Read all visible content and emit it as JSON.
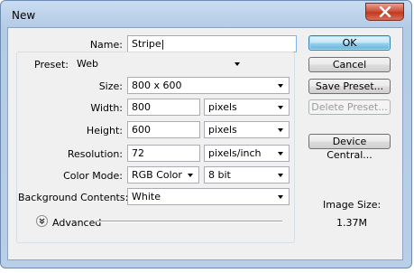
{
  "window": {
    "title": "New"
  },
  "name_row": {
    "label": "Name:",
    "value": "Stripe"
  },
  "preset": {
    "label": "Preset:",
    "value": "Web"
  },
  "size": {
    "label": "Size:",
    "value": "800 x 600"
  },
  "width": {
    "label": "Width:",
    "value": "800",
    "unit": "pixels"
  },
  "height": {
    "label": "Height:",
    "value": "600",
    "unit": "pixels"
  },
  "resolution": {
    "label": "Resolution:",
    "value": "72",
    "unit": "pixels/inch"
  },
  "color_mode": {
    "label": "Color Mode:",
    "value": "RGB Color",
    "depth": "8 bit"
  },
  "background": {
    "label": "Background Contents:",
    "value": "White"
  },
  "advanced": {
    "label": "Advanced"
  },
  "buttons": {
    "ok": "OK",
    "cancel": "Cancel",
    "save_preset": "Save Preset...",
    "delete_preset": "Delete Preset...",
    "device_central": "Device Central..."
  },
  "image_size": {
    "label": "Image Size:",
    "value": "1.37M"
  },
  "icons": {
    "close": "close-icon",
    "advanced": "chevron-double-down-icon",
    "dropdown": "dropdown-arrow-icon"
  },
  "colors": {
    "titlebar": "#b9cfe8",
    "close_button": "#c0391f",
    "dialog_bg": "#f0f0f0",
    "default_button": "#98d1ef"
  }
}
